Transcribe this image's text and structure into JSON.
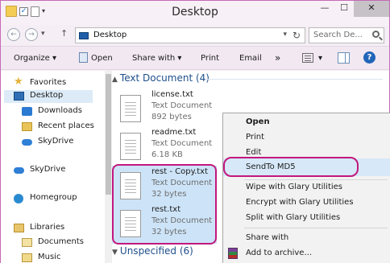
{
  "window": {
    "title": "Desktop",
    "close_label": "✕",
    "minimize_label": "—",
    "maximize_label": "☐"
  },
  "nav": {
    "back_glyph": "←",
    "forward_glyph": "→",
    "recent_glyph": "▾",
    "up_glyph": "↑",
    "address": "Desktop",
    "address_dropdown_glyph": "▾",
    "refresh_glyph": "↻",
    "search_placeholder": "Search De..."
  },
  "toolbar": {
    "organize": "Organize ▾",
    "open": "Open",
    "share_with": "Share with ▾",
    "print": "Print",
    "email": "Email",
    "more": "»",
    "views_dropdown": "▾",
    "help": "?"
  },
  "sidebar": {
    "items": [
      {
        "label": "Favorites",
        "icon": "star-icon"
      },
      {
        "label": "Desktop",
        "icon": "desktop-icon",
        "selected": true
      },
      {
        "label": "Downloads",
        "icon": "downloads-icon"
      },
      {
        "label": "Recent places",
        "icon": "recent-places-icon"
      },
      {
        "label": "SkyDrive",
        "icon": "skydrive-icon"
      },
      {
        "label": "SkyDrive",
        "icon": "skydrive-icon"
      },
      {
        "label": "Homegroup",
        "icon": "homegroup-icon"
      },
      {
        "label": "Libraries",
        "icon": "libraries-icon"
      },
      {
        "label": "Documents",
        "icon": "documents-icon"
      },
      {
        "label": "Music",
        "icon": "music-icon"
      }
    ]
  },
  "content": {
    "group1": {
      "chevron": "▲",
      "label": "Text Document (4)"
    },
    "group2": {
      "chevron": "▼",
      "label": "Unspecified (6)"
    },
    "files": [
      {
        "name": "license.txt",
        "type": "Text Document",
        "size": "892 bytes",
        "selected": false
      },
      {
        "name": "readme.txt",
        "type": "Text Document",
        "size": "6.18 KB",
        "selected": false
      },
      {
        "name": "rest - Copy.txt",
        "type": "Text Document",
        "size": "32 bytes",
        "selected": true
      },
      {
        "name": "rest.txt",
        "type": "Text Document",
        "size": "32 bytes",
        "selected": true
      }
    ]
  },
  "context_menu": {
    "items": [
      {
        "label": "Open",
        "bold": true
      },
      {
        "label": "Print"
      },
      {
        "label": "Edit"
      },
      {
        "label": "SendTo MD5",
        "hover": true
      },
      {
        "label": "Wipe with Glary Utilities"
      },
      {
        "label": "Encrypt with Glary Utilities"
      },
      {
        "label": "Split with Glary Utilities"
      },
      {
        "label": "Share with"
      },
      {
        "label": "Add to archive..."
      }
    ]
  },
  "colors": {
    "highlight": "#c2187d",
    "selection": "#cde4f8",
    "menu_hover": "#d7e8f8",
    "link_blue": "#1e4f8c"
  }
}
